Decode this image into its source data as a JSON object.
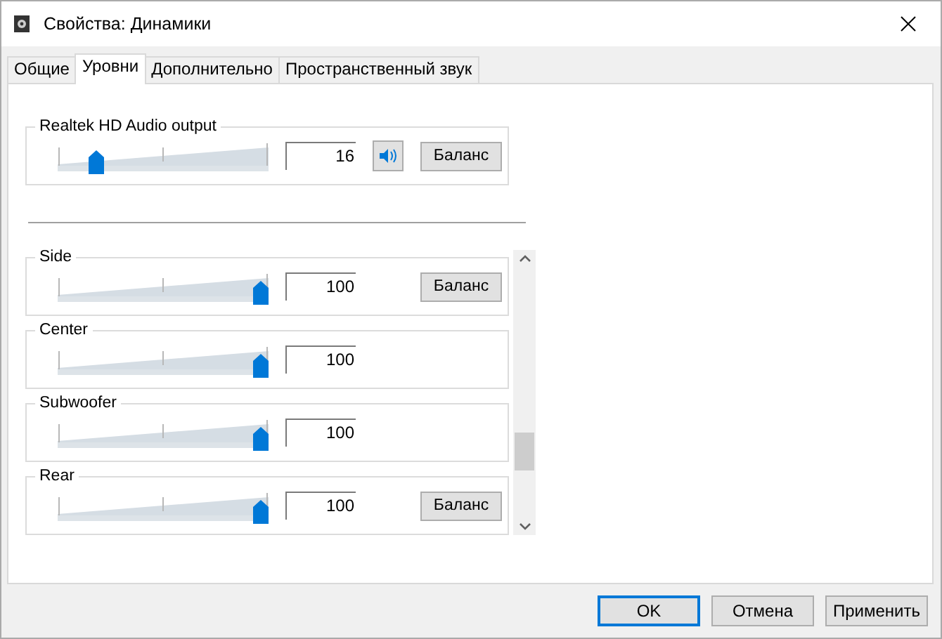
{
  "window": {
    "title": "Свойства: Динамики"
  },
  "tabs": [
    {
      "label": "Общие",
      "selected": false
    },
    {
      "label": "Уровни",
      "selected": true
    },
    {
      "label": "Дополнительно",
      "selected": false
    },
    {
      "label": "Пространственный звук",
      "selected": false
    }
  ],
  "master": {
    "name": "Realtek HD Audio output",
    "level": 0.16,
    "reading": "16",
    "muted": false,
    "balance": "Баланс"
  },
  "channels": [
    {
      "name": "Side",
      "level": 1,
      "reading": "100",
      "balance": "Баланс"
    },
    {
      "name": "Center",
      "level": 1,
      "reading": "100"
    },
    {
      "name": "Subwoofer",
      "level": 1,
      "reading": "100"
    },
    {
      "name": "Rear",
      "level": 1,
      "reading": "100",
      "balance": "Баланс"
    }
  ],
  "buttons": [
    {
      "label": "OK",
      "default": true
    },
    {
      "label": "Отмена",
      "default": false
    },
    {
      "label": "Применить",
      "default": false
    }
  ]
}
